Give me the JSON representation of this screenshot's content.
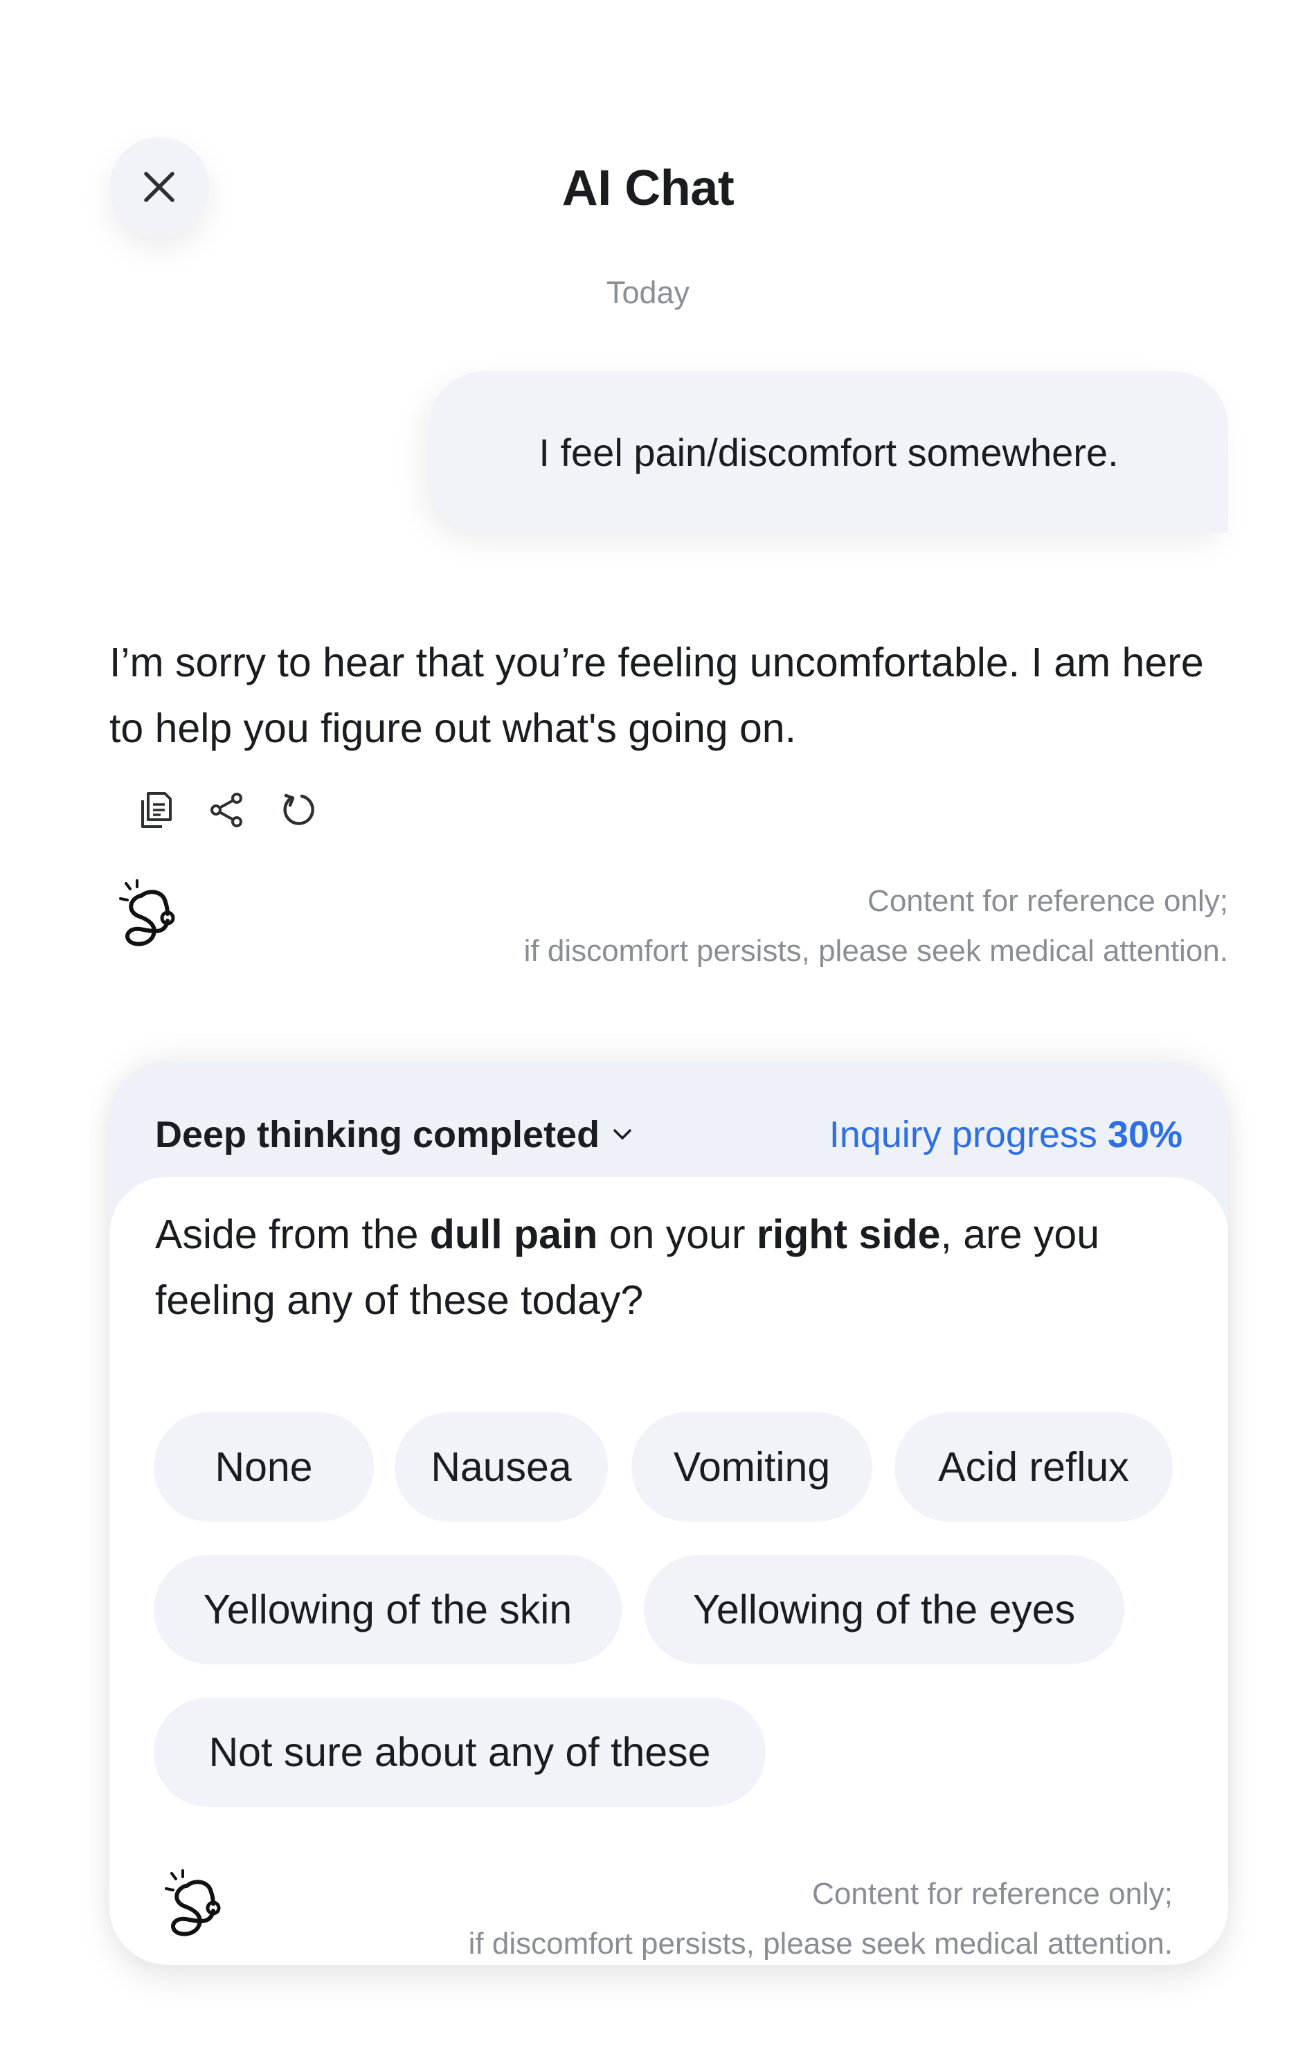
{
  "header": {
    "title": "AI Chat",
    "close_icon": "close-icon"
  },
  "chat": {
    "date_label": "Today",
    "user_message": "I feel pain/discomfort somewhere.",
    "ai_reply": "I’m sorry to hear that you’re feeling uncomfortable. I am here to help you figure out what's going on.",
    "actions": [
      "copy-icon",
      "share-icon",
      "regenerate-icon"
    ],
    "disclaimer": {
      "line1": "Content for reference only;",
      "line2": "if discomfort persists, please seek medical attention."
    }
  },
  "card": {
    "thinking_label": "Deep thinking completed",
    "progress_label": "Inquiry progress",
    "progress_value": "30%",
    "question": {
      "part1": "Aside from the ",
      "bold1": "dull pain",
      "part2": " on your ",
      "bold2": "right side",
      "part3": ", are you feeling any of these today?"
    },
    "options": [
      "None",
      "Nausea",
      "Vomiting",
      "Acid reflux",
      "Yellowing of the skin",
      "Yellowing of the eyes",
      "Not sure about any of these"
    ],
    "disclaimer": {
      "line1": "Content for reference only;",
      "line2": "if discomfort persists, please seek medical attention."
    }
  },
  "colors": {
    "accent": "#2f6fe4",
    "bubble": "#f1f3f8",
    "card_header": "#eef1f8",
    "muted_text": "#8a8d94"
  }
}
